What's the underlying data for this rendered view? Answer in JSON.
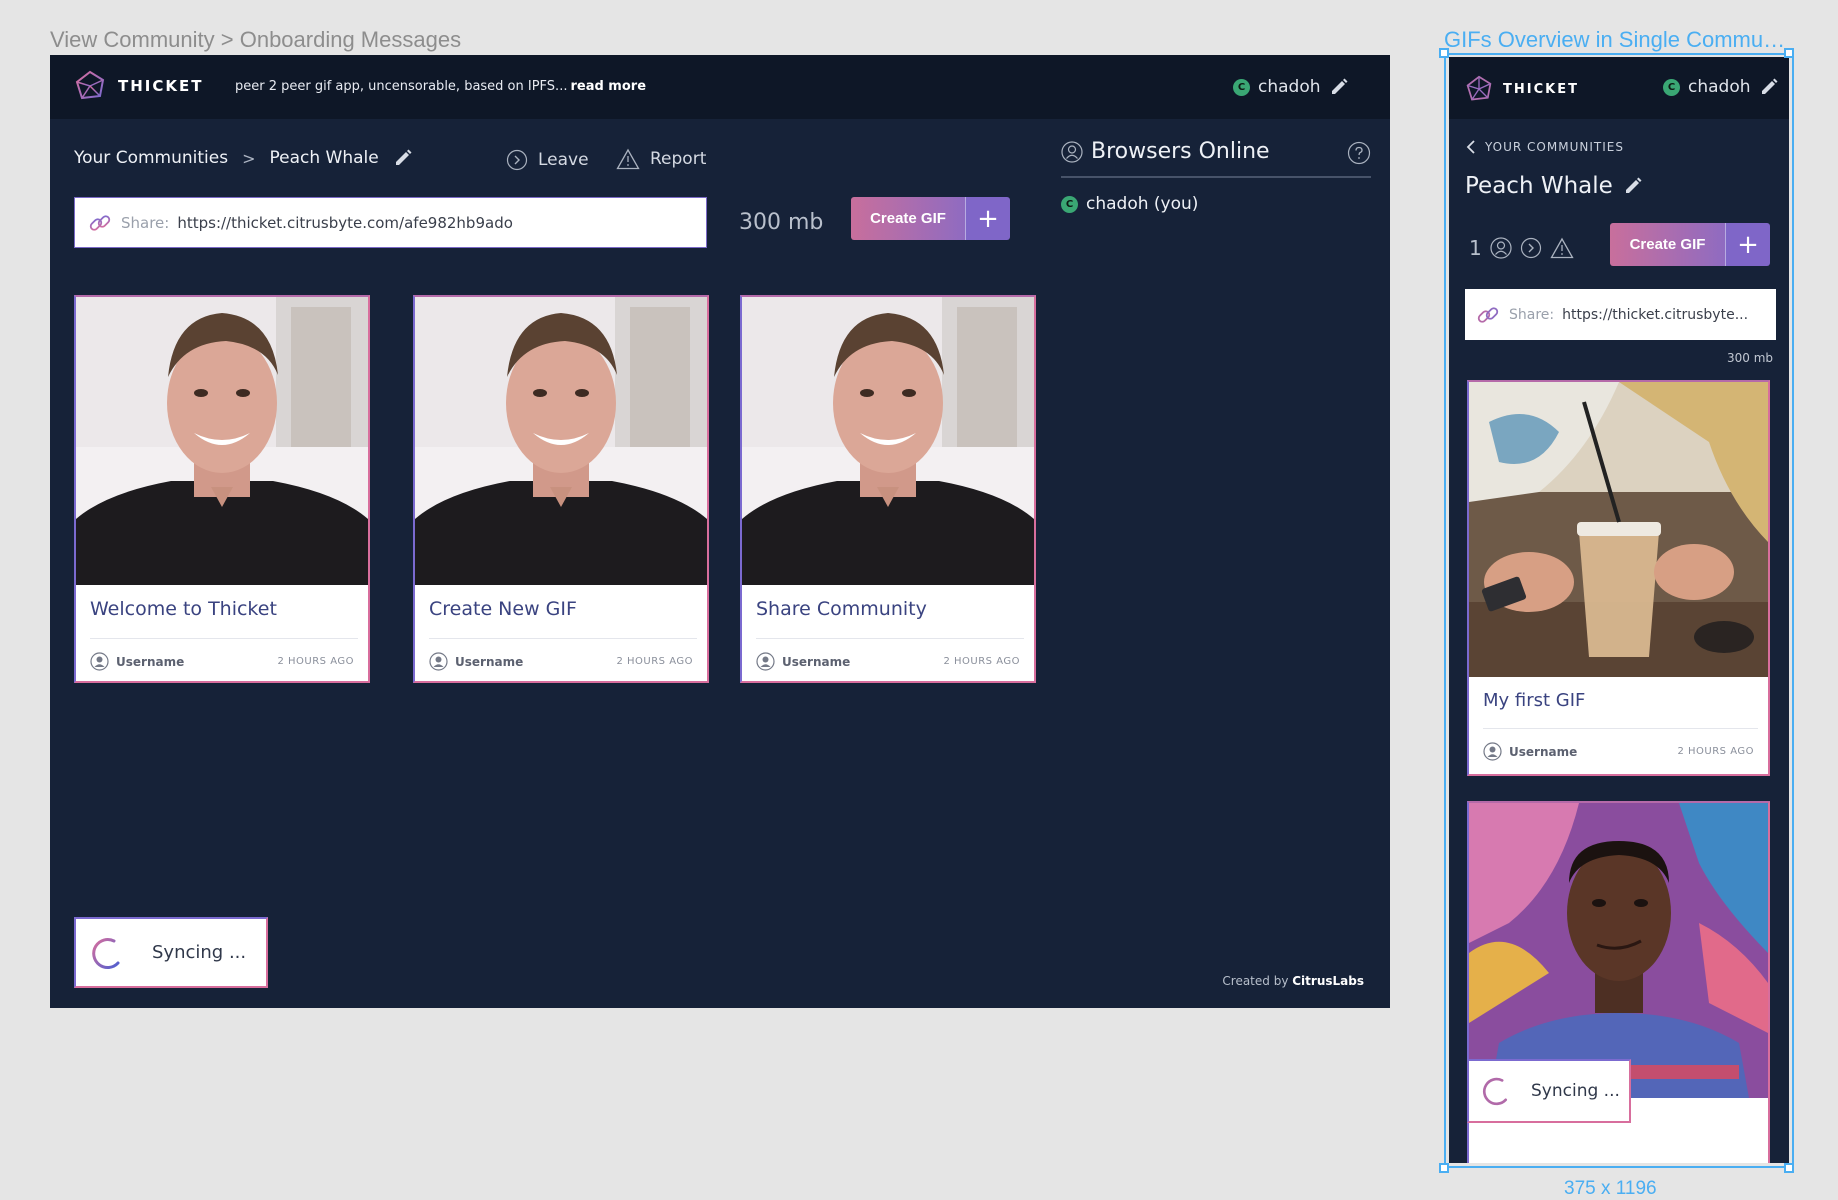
{
  "artboards": {
    "desktop_label": "View Community > Onboarding Messages",
    "mobile_label": "GIFs Overview in Single Commun...",
    "mobile_size": "375 x 1196"
  },
  "brand": {
    "name": "THICKET",
    "tagline": "peer 2 peer gif app, uncensorable, based on IPFS...",
    "read_more": "read more"
  },
  "user": {
    "initial": "C",
    "name": "chadoh"
  },
  "breadcrumb": {
    "root": "Your Communities",
    "separator": ">",
    "current": "Peach Whale"
  },
  "actions": {
    "leave": "Leave",
    "report": "Report"
  },
  "share": {
    "label": "Share:",
    "url": "https://thicket.citrusbyte.com/afe982hb9ado",
    "url_short": "https://thicket.citrusbyte..."
  },
  "storage": {
    "desktop": "300 mb",
    "mobile": "300 mb"
  },
  "create_gif": {
    "label": "Create GIF",
    "plus": "+"
  },
  "cards": [
    {
      "title": "Welcome to Thicket",
      "user": "Username",
      "time": "2 HOURS AGO"
    },
    {
      "title": "Create New GIF",
      "user": "Username",
      "time": "2 HOURS AGO"
    },
    {
      "title": "Share Community",
      "user": "Username",
      "time": "2 HOURS AGO"
    }
  ],
  "online": {
    "title": "Browsers Online",
    "users": [
      "chadoh (you)"
    ]
  },
  "sync": {
    "label": "Syncing ..."
  },
  "footer": {
    "prefix": "Created by",
    "brand": "CitrusLabs"
  },
  "mobile": {
    "back": "YOUR COMMUNITIES",
    "title": "Peach Whale",
    "member_count": "1",
    "cards": [
      {
        "title": "My first GIF",
        "user": "Username",
        "time": "2 HOURS AGO"
      }
    ]
  },
  "colors": {
    "bg": "#162238",
    "topbar": "#0e1727",
    "accent_pink": "#d86e9d",
    "accent_purple": "#7b6ad0",
    "online_green": "#3aa774",
    "selection_blue": "#4aaef2"
  }
}
